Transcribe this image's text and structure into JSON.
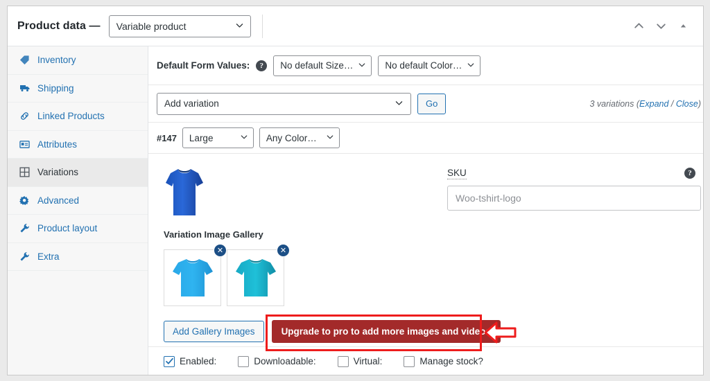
{
  "header": {
    "title": "Product data —",
    "product_type": "Variable product",
    "actions": [
      {
        "name": "move-up",
        "icon": "chevron-up-icon"
      },
      {
        "name": "move-down",
        "icon": "chevron-down-icon"
      },
      {
        "name": "toggle-panel",
        "icon": "triangle-up-icon"
      }
    ]
  },
  "sidebar": {
    "items": [
      {
        "label": "Inventory",
        "icon": "tag-icon",
        "active": false
      },
      {
        "label": "Shipping",
        "icon": "truck-icon",
        "active": false
      },
      {
        "label": "Linked Products",
        "icon": "link-icon",
        "active": false
      },
      {
        "label": "Attributes",
        "icon": "list-card-icon",
        "active": false
      },
      {
        "label": "Variations",
        "icon": "grid-icon",
        "active": true
      },
      {
        "label": "Advanced",
        "icon": "gear-icon",
        "active": false
      },
      {
        "label": "Product layout",
        "icon": "wrench-icon",
        "active": false
      },
      {
        "label": "Extra",
        "icon": "wrench-icon",
        "active": false
      }
    ]
  },
  "default_form_values": {
    "label": "Default Form Values:",
    "help_icon": "help-icon",
    "size_select": "No default Size…",
    "color_select": "No default Color…"
  },
  "add_variation": {
    "select_value": "Add variation",
    "go_label": "Go",
    "count_text": "3 variations ",
    "paren_open": "(",
    "expand_label": "Expand",
    "separator": " / ",
    "close_label": "Close",
    "paren_close": ")"
  },
  "variation": {
    "id": "#147",
    "size_value": "Large",
    "color_value": "Any Color…",
    "gallery_label": "Variation Image Gallery",
    "main_image_alt": "blue-tshirt-image",
    "thumbnails": [
      {
        "alt": "light-blue-tshirt-thumbnail",
        "remove_icon": "close-circle-icon"
      },
      {
        "alt": "teal-tshirt-thumbnail",
        "remove_icon": "close-circle-icon"
      }
    ],
    "add_gallery_label": "Add Gallery Images",
    "upgrade_label": "Upgrade to pro to add more images and videos",
    "sku_label": "SKU",
    "sku_value": "Woo-tshirt-logo",
    "sku_help_icon": "help-icon"
  },
  "checkboxes": [
    {
      "label": "Enabled:",
      "checked": true
    },
    {
      "label": "Downloadable:",
      "checked": false
    },
    {
      "label": "Virtual:",
      "checked": false
    },
    {
      "label": "Manage stock?",
      "checked": false
    }
  ],
  "annotation": {
    "highlight_color": "#ee1c1c",
    "arrow_icon": "arrow-left-icon"
  },
  "colors": {
    "link": "#2271b1",
    "upgrade_button": "#a32a2a",
    "annotation": "#ee1c1c"
  }
}
